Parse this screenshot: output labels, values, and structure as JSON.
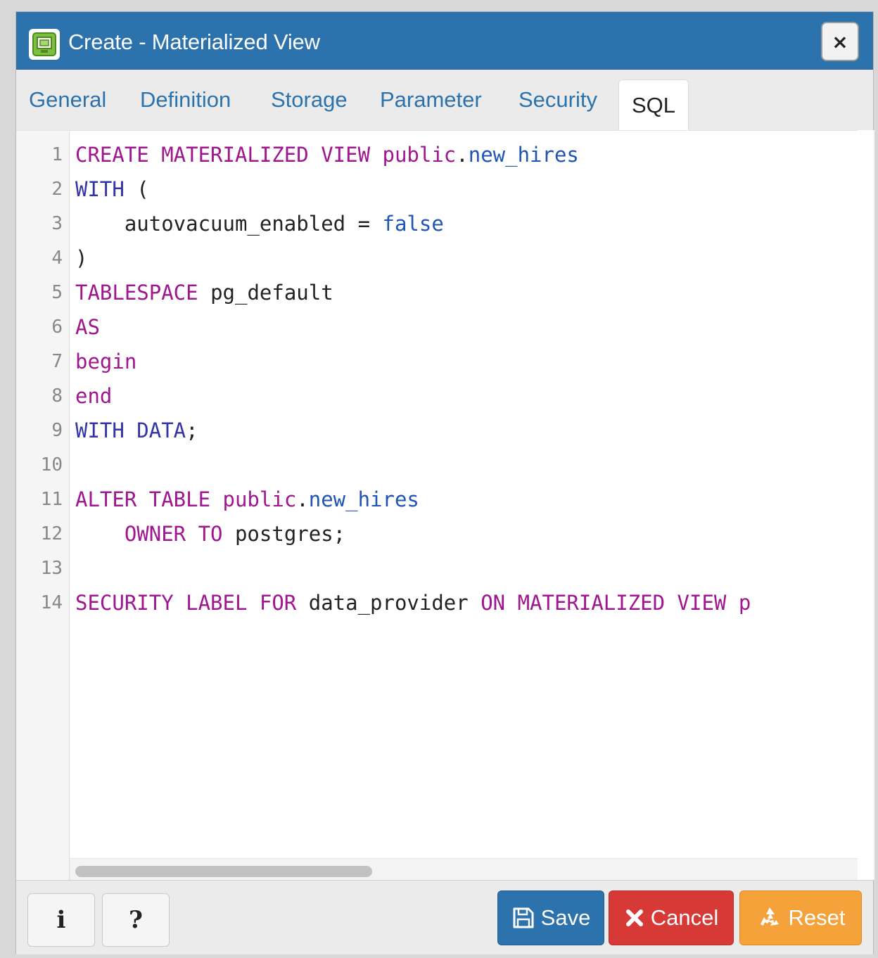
{
  "dialog": {
    "title": "Create - Materialized View",
    "close_label": "×"
  },
  "tabs": [
    {
      "label": "General"
    },
    {
      "label": "Definition"
    },
    {
      "label": "Storage"
    },
    {
      "label": "Parameter"
    },
    {
      "label": "Security"
    },
    {
      "label": "SQL",
      "active": true
    }
  ],
  "editor": {
    "line_numbers": [
      "1",
      "2",
      "3",
      "4",
      "5",
      "6",
      "7",
      "8",
      "9",
      "10",
      "11",
      "12",
      "13",
      "14"
    ],
    "lines": [
      [
        {
          "t": "CREATE MATERIALIZED VIEW ",
          "c": "kw"
        },
        {
          "t": "public",
          "c": "kw"
        },
        {
          "t": ".",
          "c": ""
        },
        {
          "t": "new_hires",
          "c": "ident"
        }
      ],
      [
        {
          "t": "WITH",
          "c": "kw2"
        },
        {
          "t": " (",
          "c": ""
        }
      ],
      [
        {
          "t": "    autovacuum_enabled = ",
          "c": ""
        },
        {
          "t": "false",
          "c": "bool"
        }
      ],
      [
        {
          "t": ")",
          "c": ""
        }
      ],
      [
        {
          "t": "TABLESPACE",
          "c": "kw"
        },
        {
          "t": " pg_default",
          "c": ""
        }
      ],
      [
        {
          "t": "AS",
          "c": "kw"
        }
      ],
      [
        {
          "t": "begin",
          "c": "kw"
        }
      ],
      [
        {
          "t": "end",
          "c": "kw"
        }
      ],
      [
        {
          "t": "WITH DATA",
          "c": "kw2"
        },
        {
          "t": ";",
          "c": ""
        }
      ],
      [],
      [
        {
          "t": "ALTER TABLE ",
          "c": "kw"
        },
        {
          "t": "public",
          "c": "kw"
        },
        {
          "t": ".",
          "c": ""
        },
        {
          "t": "new_hires",
          "c": "ident"
        }
      ],
      [
        {
          "t": "    OWNER TO",
          "c": "kw"
        },
        {
          "t": " postgres;",
          "c": ""
        }
      ],
      [],
      [
        {
          "t": "SECURITY LABEL FOR",
          "c": "kw"
        },
        {
          "t": " data_provider ",
          "c": ""
        },
        {
          "t": "ON MATERIALIZED VIEW ",
          "c": "kw"
        },
        {
          "t": "p",
          "c": "kw"
        }
      ]
    ]
  },
  "footer": {
    "info_label": "i",
    "help_label": "?",
    "save_label": "Save",
    "cancel_label": "Cancel",
    "reset_label": "Reset"
  },
  "colors": {
    "titlebar": "#2c72ad",
    "save": "#2c72ad",
    "cancel": "#d73a36",
    "reset": "#f5a23a",
    "keyword": "#a0168f",
    "identifier": "#1f55b5"
  }
}
